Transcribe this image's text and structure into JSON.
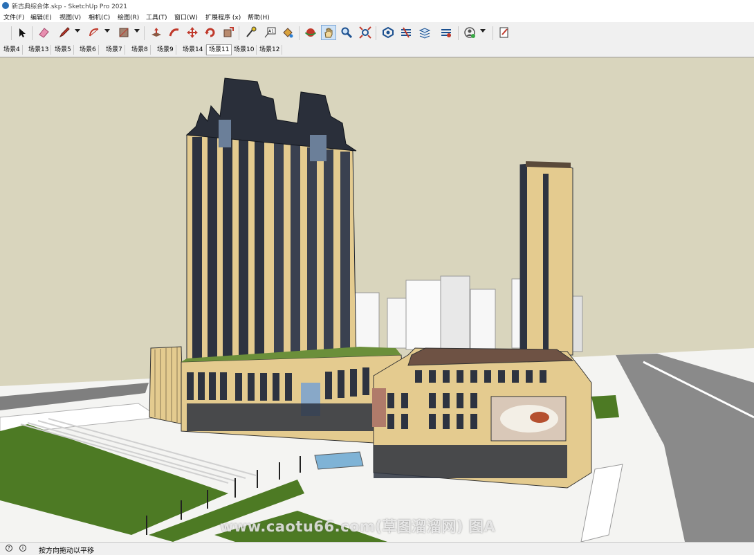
{
  "window": {
    "title": "新古典综合体.skp - SketchUp Pro 2021"
  },
  "menu": {
    "items": [
      "文件(F)",
      "编辑(E)",
      "视图(V)",
      "相机(C)",
      "绘图(R)",
      "工具(T)",
      "窗口(W)",
      "扩展程序 (x)",
      "帮助(H)"
    ]
  },
  "toolbar": {
    "tools": [
      "select",
      "eraser",
      "pencil-line",
      "arc",
      "rectangle",
      "push-pull",
      "follow-me",
      "move",
      "rotate",
      "scale",
      "tape-measure",
      "text-label",
      "paint-bucket",
      "orbit",
      "pan",
      "zoom",
      "zoom-extents",
      "warehouse",
      "extension-warehouse",
      "layout",
      "send-to-layout",
      "account",
      "style"
    ],
    "active_tool": "pan"
  },
  "scenes": {
    "tabs": [
      "场景4",
      "场景13",
      "场景5",
      "场景6",
      "场景7",
      "场景8",
      "场景9",
      "场景14",
      "场景11",
      "场景10",
      "场景12"
    ],
    "active": "场景11"
  },
  "viewport": {
    "sky_color": "#d9d5bd",
    "facade_color": "#e4cb8f",
    "glass_color": "#2d3340",
    "ground_color": "#f4f4f2",
    "lawn_color": "#4d7a24"
  },
  "status": {
    "text": "按方向拖动以平移"
  },
  "watermark": {
    "text": "www.caotu66.com(草图溜溜网) 图A"
  }
}
